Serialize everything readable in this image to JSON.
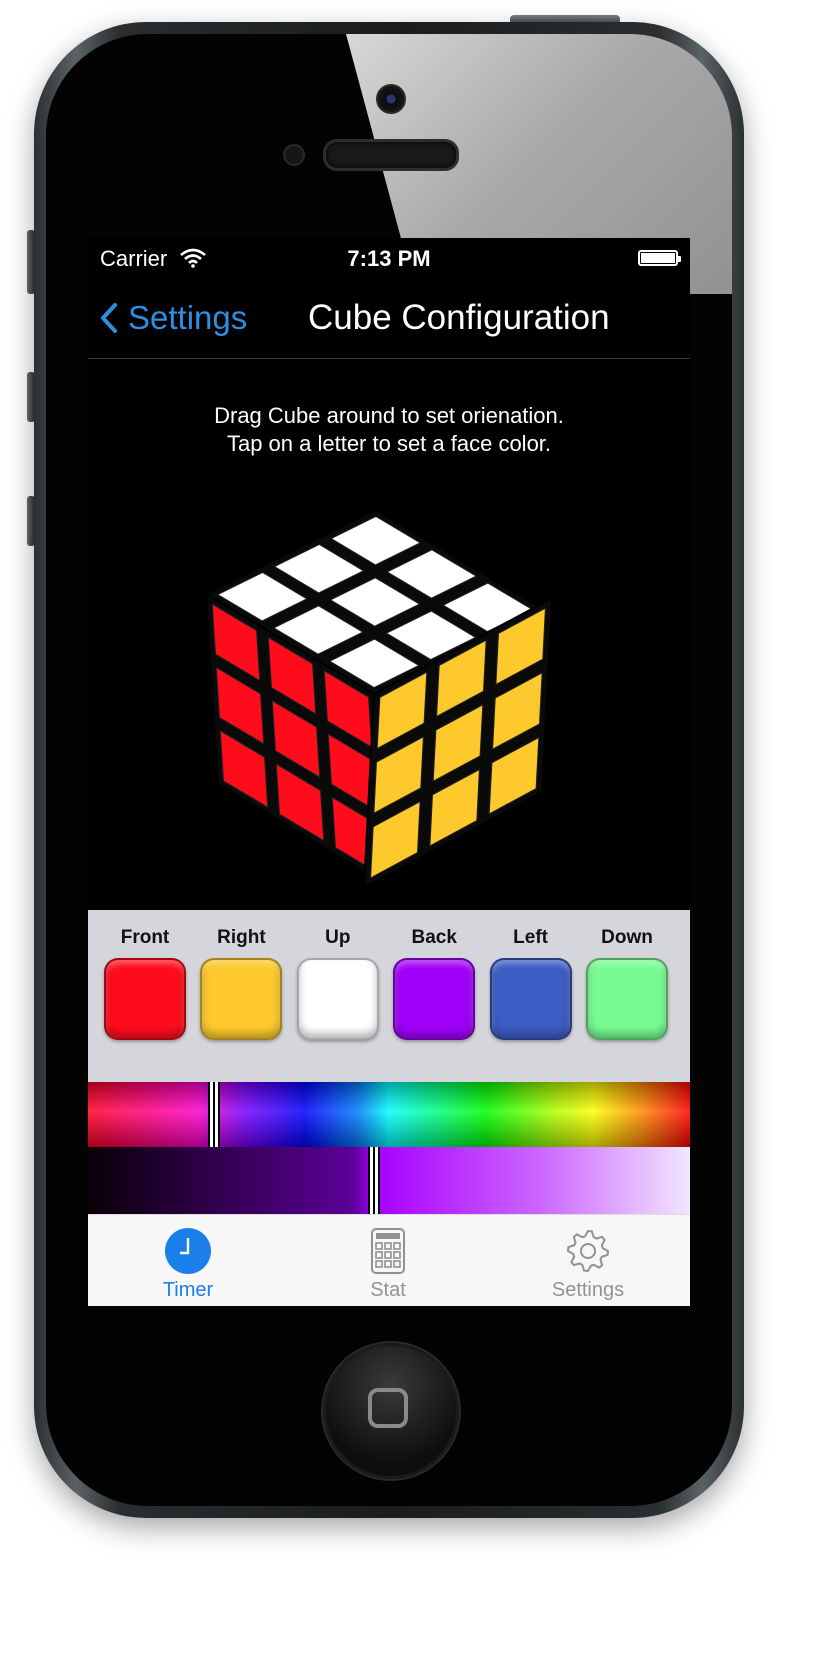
{
  "status_bar": {
    "carrier": "Carrier",
    "time": "7:13 PM"
  },
  "nav": {
    "back_label": "Settings",
    "title": "Cube Configuration"
  },
  "instructions": {
    "line1": "Drag Cube around to set orienation.",
    "line2": "Tap on a letter to set a face color."
  },
  "faces": [
    {
      "label": "Front",
      "color": "#ff0c1c"
    },
    {
      "label": "Right",
      "color": "#fdc92c"
    },
    {
      "label": "Up",
      "color": "#ffffff"
    },
    {
      "label": "Back",
      "color": "#a000f8"
    },
    {
      "label": "Left",
      "color": "#3d5cc4"
    },
    {
      "label": "Down",
      "color": "#78fb92"
    }
  ],
  "color_picker": {
    "hue_position": 0.2,
    "shade_position": 0.465
  },
  "cube": {
    "up_color": "#ffffff",
    "front_color": "#ff0c1c",
    "right_color": "#fdc92c"
  },
  "tabs": [
    {
      "label": "Timer",
      "icon": "clock-icon",
      "active": true
    },
    {
      "label": "Stat",
      "icon": "calculator-icon",
      "active": false
    },
    {
      "label": "Settings",
      "icon": "gear-icon",
      "active": false
    }
  ],
  "colors": {
    "accent": "#1a7fe8",
    "back_button": "#2d8fe0"
  }
}
